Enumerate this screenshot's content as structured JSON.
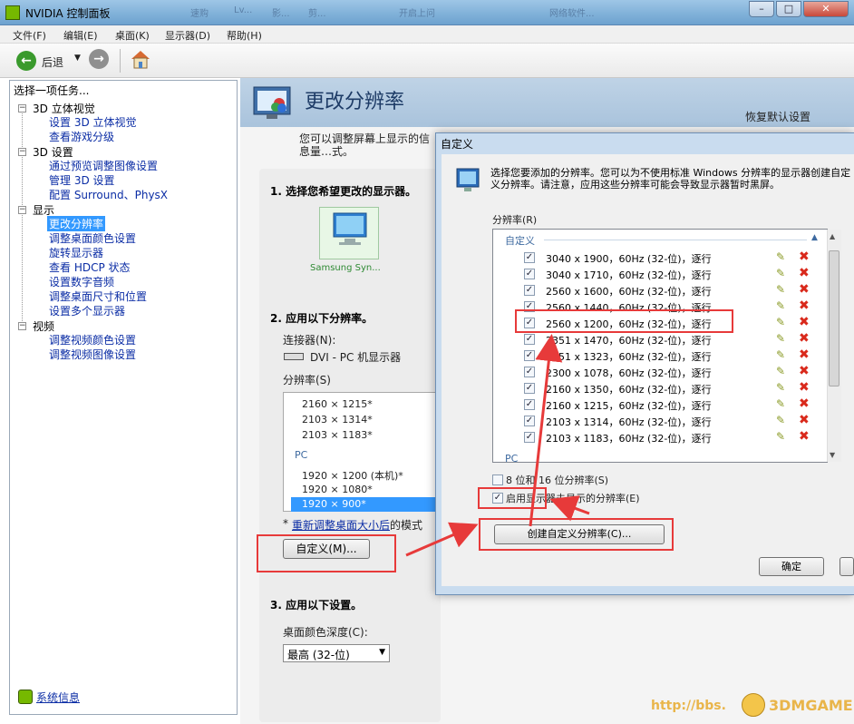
{
  "window": {
    "title": "NVIDIA 控制面板",
    "background_tabs": [
      "速购",
      "Lv...",
      "影...",
      "剪...",
      "开启上问",
      "网络软件..."
    ]
  },
  "menu": [
    "文件(F)",
    "编辑(E)",
    "桌面(K)",
    "显示器(D)",
    "帮助(H)"
  ],
  "toolbar": {
    "back_label": "后退",
    "back_icon": "back-arrow-icon",
    "forward_icon": "forward-arrow-icon",
    "home_icon": "home-icon"
  },
  "left_pane": {
    "heading": "选择一项任务...",
    "groups": [
      {
        "label": "3D 立体视觉",
        "items": [
          "设置 3D 立体视觉",
          "查看游戏分级"
        ]
      },
      {
        "label": "3D 设置",
        "items": [
          "通过预览调整图像设置",
          "管理 3D 设置",
          "配置 Surround、PhysX"
        ]
      },
      {
        "label": "显示",
        "items": [
          "更改分辨率",
          "调整桌面颜色设置",
          "旋转显示器",
          "查看 HDCP 状态",
          "设置数字音频",
          "调整桌面尺寸和位置",
          "设置多个显示器"
        ]
      },
      {
        "label": "视频",
        "items": [
          "调整视频颜色设置",
          "调整视频图像设置"
        ]
      }
    ],
    "selected_item": "更改分辨率",
    "system_info": "系统信息"
  },
  "main": {
    "title": "更改分辨率",
    "restore_defaults": "恢复默认设置",
    "description": "您可以调整屏幕上显示的信息量…式。",
    "step1": "1. 选择您希望更改的显示器。",
    "monitor_name": "Samsung Syn...",
    "step2": "2. 应用以下分辨率。",
    "connector_label": "连接器(N):",
    "connector_value": "DVI - PC 机显示器",
    "resolution_label": "分辨率(S)",
    "resolutions_custom": [
      "2160 × 1215*",
      "2103 × 1314*",
      "2103 × 1183*"
    ],
    "pc_group": "PC",
    "resolutions_pc": [
      "1920 × 1200 (本机)*",
      "1920 × 1080*",
      "1920 × 900*"
    ],
    "selected_resolution": "1920 × 900*",
    "footnote_prefix": "* ",
    "footnote_link": "重新调整桌面大小后",
    "footnote_suffix": "的模式",
    "customize_button": "自定义(M)...",
    "step3": "3. 应用以下设置。",
    "color_depth_label": "桌面颜色深度(C):",
    "color_depth_value": "最高 (32-位)"
  },
  "dialog": {
    "title": "自定义",
    "description": "选择您要添加的分辨率。您可以为不使用标准 Windows 分辨率的显示器创建自定义分辨率。请注意，应用这些分辨率可能会导致显示器暂时黑屏。",
    "list_label": "分辨率(R)",
    "group_custom": "自定义",
    "rows": [
      "3040 x 1900，60Hz (32-位)，逐行",
      "3040 x 1710，60Hz (32-位)，逐行",
      "2560 x 1600，60Hz (32-位)，逐行",
      "2560 x 1440，60Hz (32-位)，逐行",
      "2560 x 1200，60Hz (32-位)，逐行",
      "2351 x 1470，60Hz (32-位)，逐行",
      "2351 x 1323，60Hz (32-位)，逐行",
      "2300 x 1078，60Hz (32-位)，逐行",
      "2160 x 1350，60Hz (32-位)，逐行",
      "2160 x 1215，60Hz (32-位)，逐行",
      "2103 x 1314，60Hz (32-位)，逐行",
      "2103 x 1183，60Hz (32-位)，逐行"
    ],
    "group_pc": "PC",
    "opt_8_16": "8 位和 16 位分辨率(S)",
    "opt_8_16_checked": false,
    "opt_unexposed": "启用显示器未显示的分辨率(E)",
    "opt_unexposed_checked": true,
    "create_button": "创建自定义分辨率(C)...",
    "ok_button": "确定"
  },
  "watermark": {
    "url": "http://bbs.",
    "brand": "3DMGAME"
  },
  "colors": {
    "annotation_red": "#e73a3a",
    "selection_blue": "#3399ff",
    "link_blue": "#0b2da5",
    "nvidia_green": "#76b900"
  }
}
